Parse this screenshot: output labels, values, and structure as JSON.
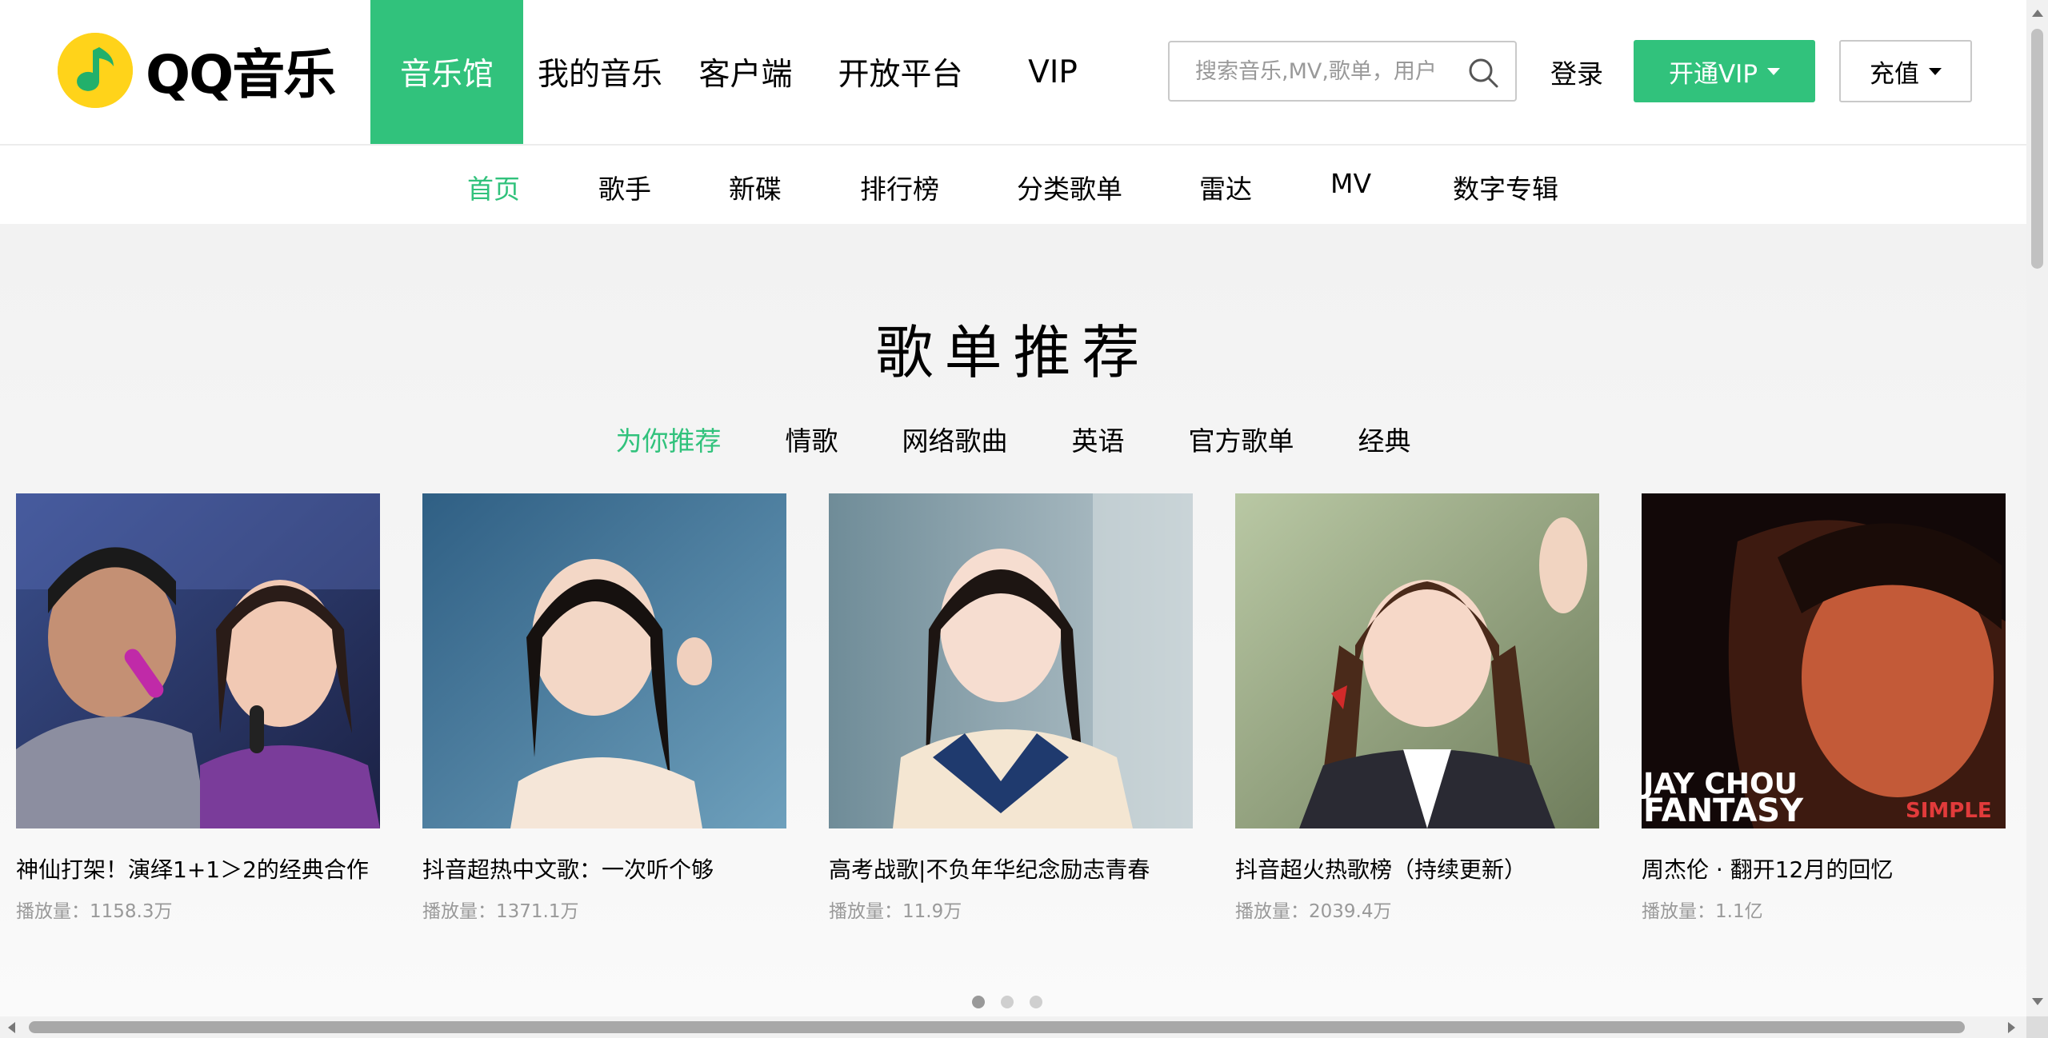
{
  "brand": {
    "name": "QQ音乐",
    "logo_icon": "qq-music-note-icon",
    "logo_color": "#ffd31a"
  },
  "colors": {
    "accent": "#31c27c",
    "muted": "#999999"
  },
  "topnav": [
    {
      "label": "音乐馆",
      "active": true
    },
    {
      "label": "我的音乐"
    },
    {
      "label": "客户端"
    },
    {
      "label": "开放平台"
    },
    {
      "label": "VIP"
    }
  ],
  "search": {
    "placeholder": "搜索音乐,MV,歌单，用户",
    "icon": "search-icon"
  },
  "account": {
    "login": "登录",
    "vip": "开通VIP",
    "recharge": "充值"
  },
  "subnav": [
    "首页",
    "歌手",
    "新碟",
    "排行榜",
    "分类歌单",
    "雷达",
    "MV",
    "数字专辑"
  ],
  "section": {
    "title": "歌单推荐",
    "tabs": [
      "为你推荐",
      "情歌",
      "网络歌曲",
      "英语",
      "官方歌单",
      "经典"
    ],
    "cards": [
      {
        "title": "神仙打架！演绎1+1＞2的经典合作",
        "plays": "播放量：1158.3万"
      },
      {
        "title": "抖音超热中文歌：一次听个够",
        "plays": "播放量：1371.1万"
      },
      {
        "title": "高考战歌|不负年华纪念励志青春",
        "plays": "播放量：11.9万"
      },
      {
        "title": "抖音超火热歌榜（持续更新）",
        "plays": "播放量：2039.4万"
      },
      {
        "title": "周杰伦 · 翻开12月的回忆",
        "plays": "播放量：1.1亿"
      }
    ],
    "cover5_text": {
      "line1": "JAY CHOU",
      "line2": "FANTASY",
      "side": "SIMPLE"
    },
    "pager": {
      "pages": 3,
      "current": 1
    }
  }
}
